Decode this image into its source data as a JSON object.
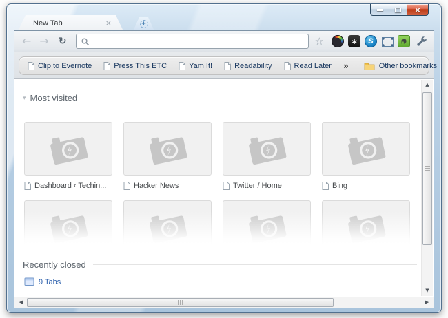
{
  "window": {
    "tab_title": "New Tab",
    "tab_close_glyph": "×",
    "newtab_glyph": "+",
    "controls": {
      "close_glyph": "×"
    }
  },
  "toolbar": {
    "back_glyph": "←",
    "forward_glyph": "→",
    "reload_glyph": "↻",
    "star_glyph": "☆",
    "omnibox_value": "",
    "extensions": {
      "asterisk_glyph": "*",
      "stumbleupon_glyph": "S"
    }
  },
  "bookmarks_bar": {
    "items": [
      {
        "label": "Clip to Evernote"
      },
      {
        "label": "Press This ETC"
      },
      {
        "label": "Yam It!"
      },
      {
        "label": "Readability"
      },
      {
        "label": "Read Later"
      }
    ],
    "overflow_glyph": "»",
    "other_bookmarks_label": "Other bookmarks"
  },
  "new_tab_page": {
    "most_visited": {
      "title": "Most visited",
      "collapse_glyph": "▾",
      "tiles": [
        {
          "label": "Dashboard ‹ Techin..."
        },
        {
          "label": "Hacker News"
        },
        {
          "label": "Twitter / Home"
        },
        {
          "label": "Bing"
        }
      ]
    },
    "recently_closed": {
      "title": "Recently closed",
      "link_label": "9 Tabs"
    }
  },
  "scrollbars": {
    "up_glyph": "▲",
    "down_glyph": "▼",
    "left_glyph": "◀",
    "right_glyph": "▶"
  },
  "icons": {
    "extension_1": "color-wheel-extension-icon",
    "extension_2": "asterisk-extension-icon",
    "extension_3": "stumbleupon-extension-icon",
    "extension_4": "capture-frame-extension-icon",
    "extension_5": "evernote-extension-icon",
    "menu": "wrench-icon",
    "thumbnail_placeholder": "camera-icon"
  },
  "colors": {
    "aero_glass_blue": "#b9d0e5",
    "close_button_red": "#bb3812",
    "bookmark_text_navy": "#17365e",
    "link_blue": "#2f62ad",
    "evernote_green": "#74b843",
    "stumbleupon_blue": "#1d88ca",
    "thumb_gray": "#f1f1f1"
  }
}
